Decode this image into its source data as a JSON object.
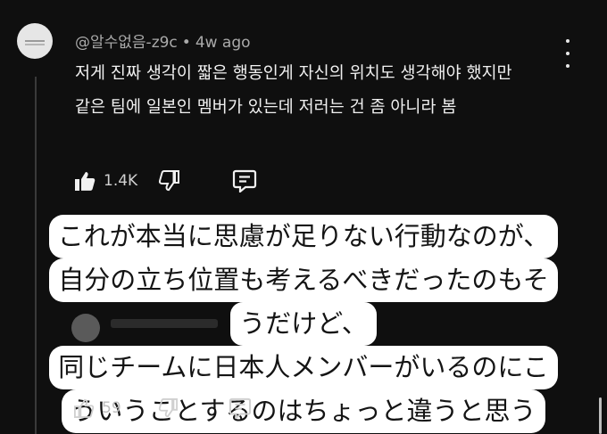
{
  "comment": {
    "author": "@알수없음-z9c",
    "separator": "•",
    "time": "4w ago",
    "body": "저게 진짜 생각이 짧은 행동인게 자신의 위치도 생각해야 했지만 같은 팀에 일본인 멤버가 있는데 저러는 건 좀 아니라 봄",
    "likes": "1.4K"
  },
  "reply": {
    "likes": "59"
  },
  "caption": {
    "lines": [
      "これが本当に思慮が足りない行動なのが、",
      "自分の立ち位置も考えるべきだったのもそ",
      "うだけど、",
      "同じチームに日本人メンバーがいるのにこ",
      "ういうことするのはちょっと違うと思う"
    ]
  },
  "icons": {
    "like": "thumbs-up-icon",
    "dislike": "thumbs-down-icon",
    "reply": "reply-comment-icon",
    "menu": "more-vertical-icon"
  },
  "colors": {
    "background": "#0f0f0f",
    "text": "#f1f1f1",
    "meta": "#aaaaaa",
    "caption_bg": "#ffffff"
  }
}
